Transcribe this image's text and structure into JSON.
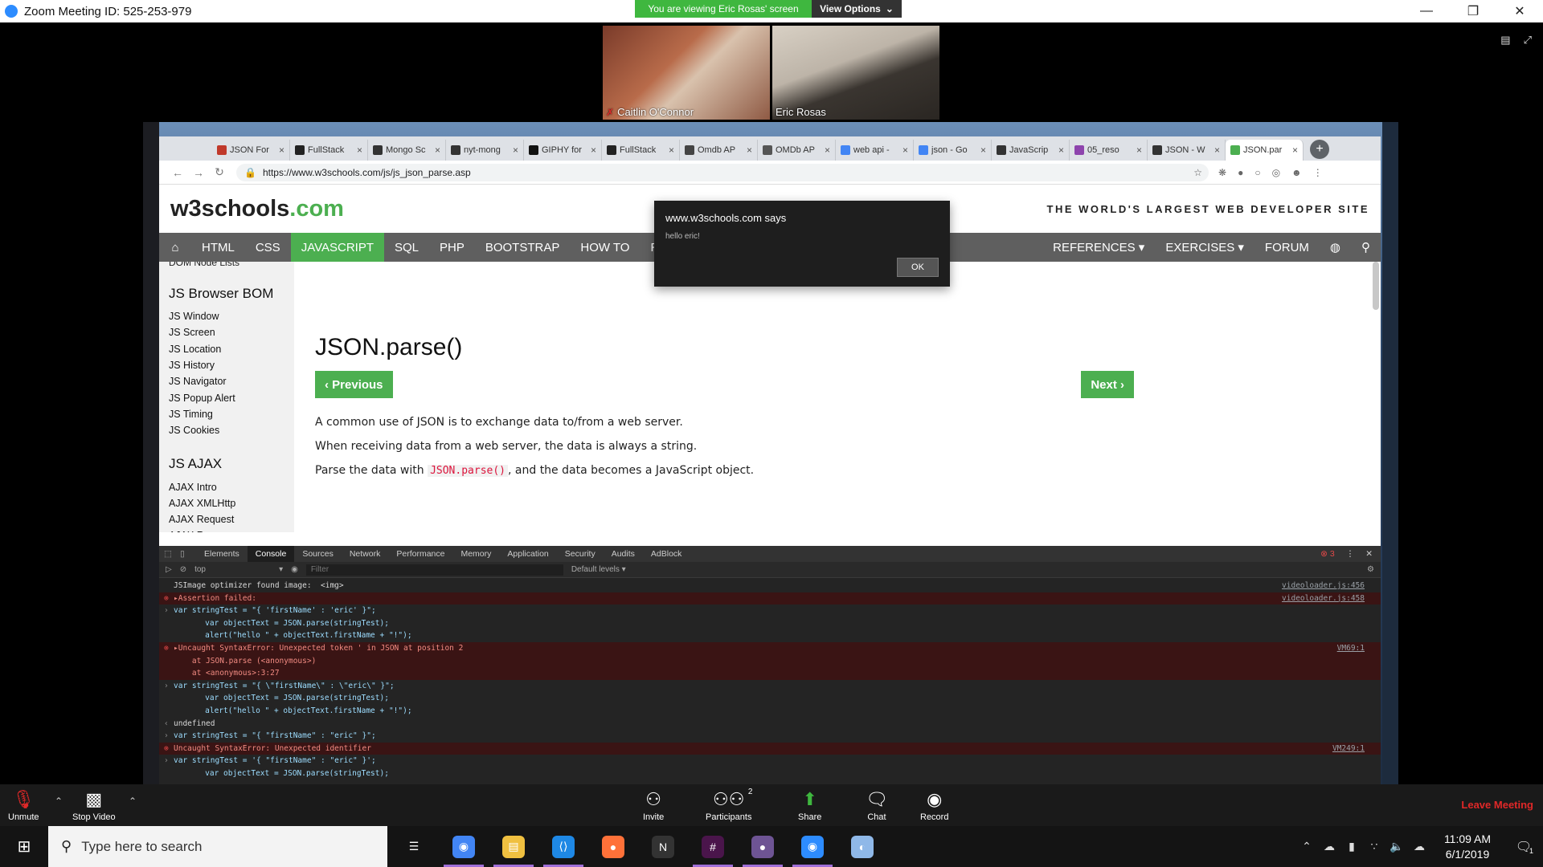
{
  "zoom": {
    "window_title": "Zoom Meeting ID: 525-253-979",
    "viewing_banner": "You are viewing Eric Rosas' screen",
    "view_options_label": "View Options",
    "participants": [
      {
        "name": "Caitlin O'Connor",
        "muted": true
      },
      {
        "name": "Eric Rosas",
        "muted": false
      }
    ],
    "bottom_bar": {
      "unmute": "Unmute",
      "stop_video": "Stop Video",
      "invite": "Invite",
      "participants": "Participants",
      "participants_count": "2",
      "share": "Share",
      "chat": "Chat",
      "record": "Record",
      "leave": "Leave Meeting"
    }
  },
  "browser": {
    "tabs": [
      {
        "label": "JSON For",
        "color": "#c0392b"
      },
      {
        "label": "FullStack",
        "color": "#222222"
      },
      {
        "label": "Mongo Sc",
        "color": "#333333"
      },
      {
        "label": "nyt-mong",
        "color": "#333333"
      },
      {
        "label": "GIPHY for",
        "color": "#111111"
      },
      {
        "label": "FullStack",
        "color": "#222222"
      },
      {
        "label": "Omdb AP",
        "color": "#444444"
      },
      {
        "label": "OMDb AP",
        "color": "#555555"
      },
      {
        "label": "web api -",
        "color": "#4285f4"
      },
      {
        "label": "json - Go",
        "color": "#4285f4"
      },
      {
        "label": "JavaScrip",
        "color": "#333333"
      },
      {
        "label": "05_reso",
        "color": "#8e44ad"
      },
      {
        "label": "JSON - W",
        "color": "#333333"
      },
      {
        "label": "JSON.par",
        "color": "#4caf50"
      }
    ],
    "active_tab_index": 13,
    "url": "https://www.w3schools.com/js/js_json_parse.asp"
  },
  "page": {
    "logo_main": "w3schools",
    "logo_suffix": ".com",
    "tagline": "THE WORLD'S LARGEST WEB DEVELOPER SITE",
    "nav_left": [
      "HTML",
      "CSS",
      "JAVASCRIPT",
      "SQL",
      "PHP",
      "BOOTSTRAP",
      "HOW TO"
    ],
    "nav_active_index": 2,
    "nav_hidden_fragment": "RE ▾",
    "nav_right": [
      "REFERENCES ▾",
      "EXERCISES ▾",
      "FORUM"
    ],
    "sidebar": {
      "cut_item": "DOM Node Lists",
      "section1_title": "JS Browser BOM",
      "section1_items": [
        "JS Window",
        "JS Screen",
        "JS Location",
        "JS History",
        "JS Navigator",
        "JS Popup Alert",
        "JS Timing",
        "JS Cookies"
      ],
      "section2_title": "JS AJAX",
      "section2_items": [
        "AJAX Intro",
        "AJAX XMLHttp",
        "AJAX Request",
        "AJAX Response"
      ]
    },
    "heading": "JSON.parse()",
    "prev_label": "‹ Previous",
    "next_label": "Next ›",
    "para1": "A common use of JSON is to exchange data to/from a web server.",
    "para2": "When receiving data from a web server, the data is always a string.",
    "para3_before": "Parse the data with ",
    "para3_code": "JSON.parse()",
    "para3_after": ", and the data becomes a JavaScript object."
  },
  "alert": {
    "from": "www.w3schools.com says",
    "message": "hello eric!",
    "ok": "OK"
  },
  "devtools": {
    "tabs": [
      "Elements",
      "Console",
      "Sources",
      "Network",
      "Performance",
      "Memory",
      "Application",
      "Security",
      "Audits",
      "AdBlock"
    ],
    "active_tab_index": 1,
    "error_count": "3",
    "context": "top",
    "filter_placeholder": "Filter",
    "levels": "Default levels ▾",
    "lines": [
      {
        "kind": "log",
        "gutter": "",
        "text": "JSImage optimizer found image:  <img>",
        "src": "videoloader.js:456"
      },
      {
        "kind": "err",
        "gutter": "⊗",
        "text": "▸Assertion failed:",
        "src": "videoloader.js:458"
      },
      {
        "kind": "in",
        "gutter": "›",
        "text": "var stringTest = \"{ 'firstName' : 'eric' }\";",
        "src": ""
      },
      {
        "kind": "in",
        "gutter": "",
        "text": "   var objectText = JSON.parse(stringTest);",
        "src": ""
      },
      {
        "kind": "in",
        "gutter": "",
        "text": "   alert(\"hello \" + objectText.firstName + \"!\");",
        "src": ""
      },
      {
        "kind": "err",
        "gutter": "⊗",
        "text": "▸Uncaught SyntaxError: Unexpected token ' in JSON at position 2\n    at JSON.parse (<anonymous>)\n    at <anonymous>:3:27",
        "src": "VM69:1"
      },
      {
        "kind": "in",
        "gutter": "›",
        "text": "var stringTest = \"{ \\\"firstName\\\" : \\\"eric\\\" }\";",
        "src": ""
      },
      {
        "kind": "in",
        "gutter": "",
        "text": "   var objectText = JSON.parse(stringTest);",
        "src": ""
      },
      {
        "kind": "in",
        "gutter": "",
        "text": "   alert(\"hello \" + objectText.firstName + \"!\");",
        "src": ""
      },
      {
        "kind": "out",
        "gutter": "‹",
        "text": "undefined",
        "src": ""
      },
      {
        "kind": "in",
        "gutter": "›",
        "text": "var stringTest = \"{ \"firstName\" : \"eric\" }\";",
        "src": ""
      },
      {
        "kind": "err",
        "gutter": "⊗",
        "text": "Uncaught SyntaxError: Unexpected identifier",
        "src": "VM249:1"
      },
      {
        "kind": "in",
        "gutter": "›",
        "text": "var stringTest = '{ \"firstName\" : \"eric\" }';",
        "src": ""
      },
      {
        "kind": "in",
        "gutter": "",
        "text": "   var objectText = JSON.parse(stringTest);",
        "src": ""
      }
    ]
  },
  "taskbar": {
    "search_placeholder": "Type here to search",
    "apps": [
      {
        "name": "task-view",
        "color": "#141414",
        "glyph": "☰",
        "running": false
      },
      {
        "name": "chrome",
        "color": "#4285f4",
        "glyph": "◉",
        "running": true
      },
      {
        "name": "file-explorer",
        "color": "#f0c040",
        "glyph": "▤",
        "running": true
      },
      {
        "name": "vscode",
        "color": "#1e88e5",
        "glyph": "⟨⟩",
        "running": true
      },
      {
        "name": "firefox",
        "color": "#ff7139",
        "glyph": "●",
        "running": false
      },
      {
        "name": "app-n",
        "color": "#333333",
        "glyph": "N",
        "running": false
      },
      {
        "name": "slack",
        "color": "#4a154b",
        "glyph": "#",
        "running": true
      },
      {
        "name": "github",
        "color": "#6e5494",
        "glyph": "●",
        "running": true
      },
      {
        "name": "zoom",
        "color": "#2d8cff",
        "glyph": "◉",
        "running": true
      },
      {
        "name": "paint",
        "color": "#8fb8e8",
        "glyph": "◐",
        "running": false
      }
    ],
    "time": "11:09 AM",
    "date": "6/1/2019",
    "notifications": "1"
  }
}
